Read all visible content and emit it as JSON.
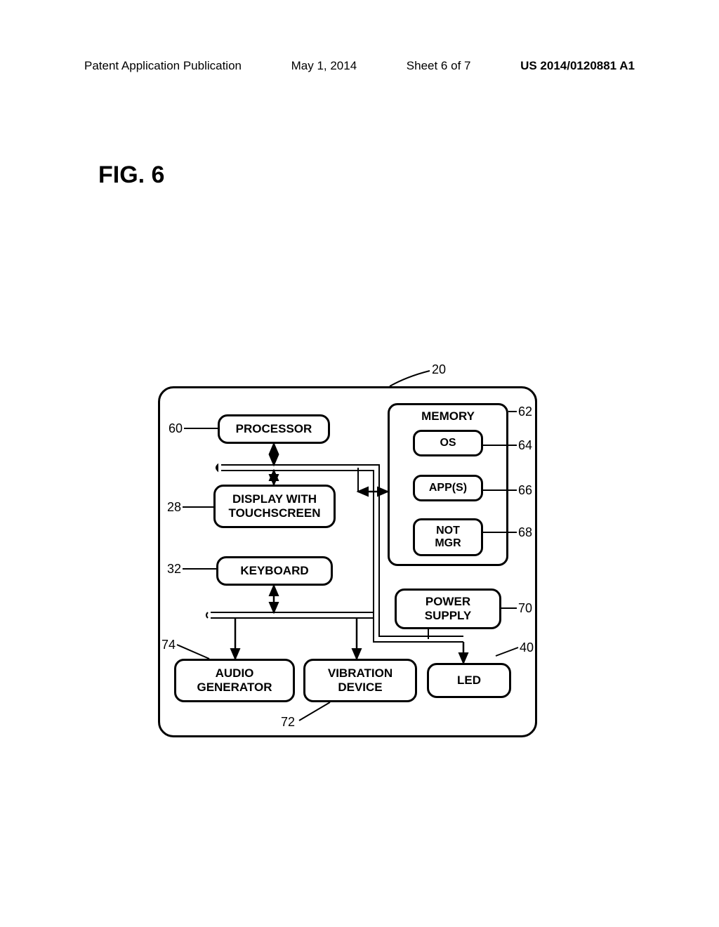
{
  "header": {
    "publication": "Patent Application Publication",
    "date": "May 1, 2014",
    "sheet": "Sheet 6 of 7",
    "number": "US 2014/0120881 A1"
  },
  "figure_label": "FIG. 6",
  "refs": {
    "r20": "20",
    "r60": "60",
    "r62": "62",
    "r64": "64",
    "r66": "66",
    "r28": "28",
    "r68": "68",
    "r32": "32",
    "r70": "70",
    "r74": "74",
    "r40": "40",
    "r72": "72"
  },
  "blocks": {
    "processor": "PROCESSOR",
    "display_l1": "DISPLAY WITH",
    "display_l2": "TOUCHSCREEN",
    "keyboard": "KEYBOARD",
    "memory": "MEMORY",
    "os": "OS",
    "apps": "APP(S)",
    "notmgr_l1": "NOT",
    "notmgr_l2": "MGR",
    "power_l1": "POWER",
    "power_l2": "SUPPLY",
    "audio_l1": "AUDIO",
    "audio_l2": "GENERATOR",
    "vibration_l1": "VIBRATION",
    "vibration_l2": "DEVICE",
    "led": "LED"
  }
}
